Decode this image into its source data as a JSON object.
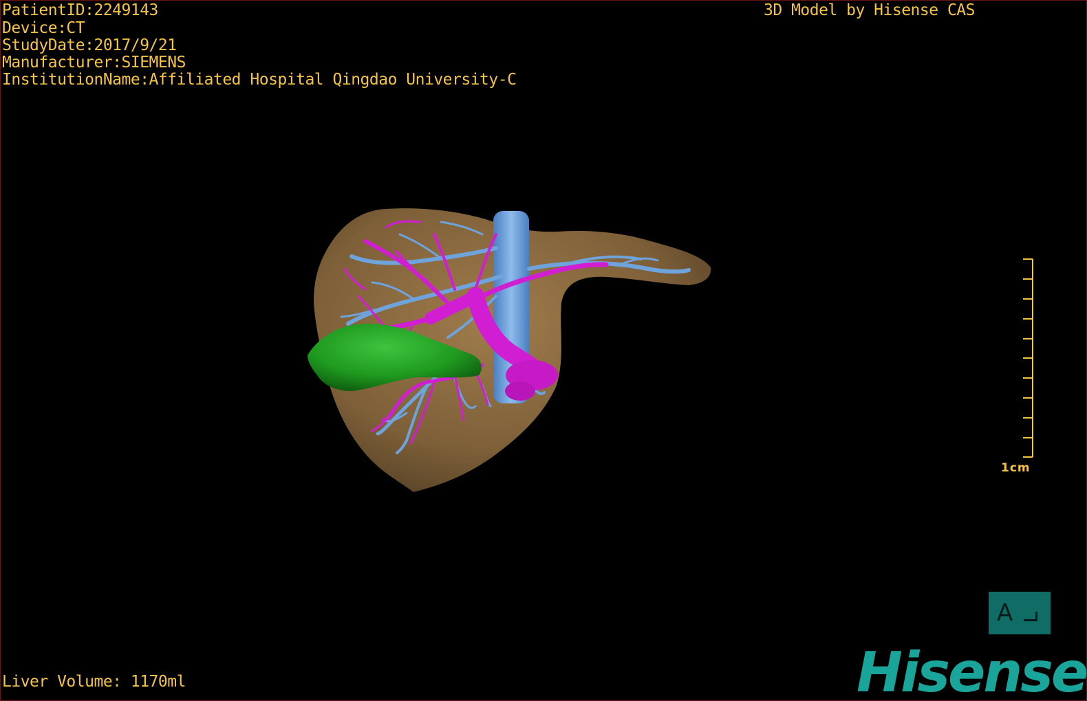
{
  "header": {
    "patient_id": "PatientID:2249143",
    "device": "Device:CT",
    "study_date": "StudyDate:2017/9/21",
    "manufacturer": "Manufacturer:SIEMENS",
    "institution": "InstitutionName:Affiliated Hospital Qingdao University-C"
  },
  "model_credit": "3D Model by Hisense CAS",
  "footer": {
    "liver_volume": "Liver Volume: 1170ml"
  },
  "scale_bar": {
    "label": "1cm"
  },
  "orientation": {
    "letter": "A"
  },
  "brand": {
    "name": "Hisense",
    "color": "#1aa59a"
  },
  "colors": {
    "overlay_text": "#f5c542",
    "liver": "#8a6a40",
    "portal_vein": "#d21ed2",
    "hepatic_vein": "#6fa3dc",
    "gallbladder": "#1f9a1f"
  }
}
